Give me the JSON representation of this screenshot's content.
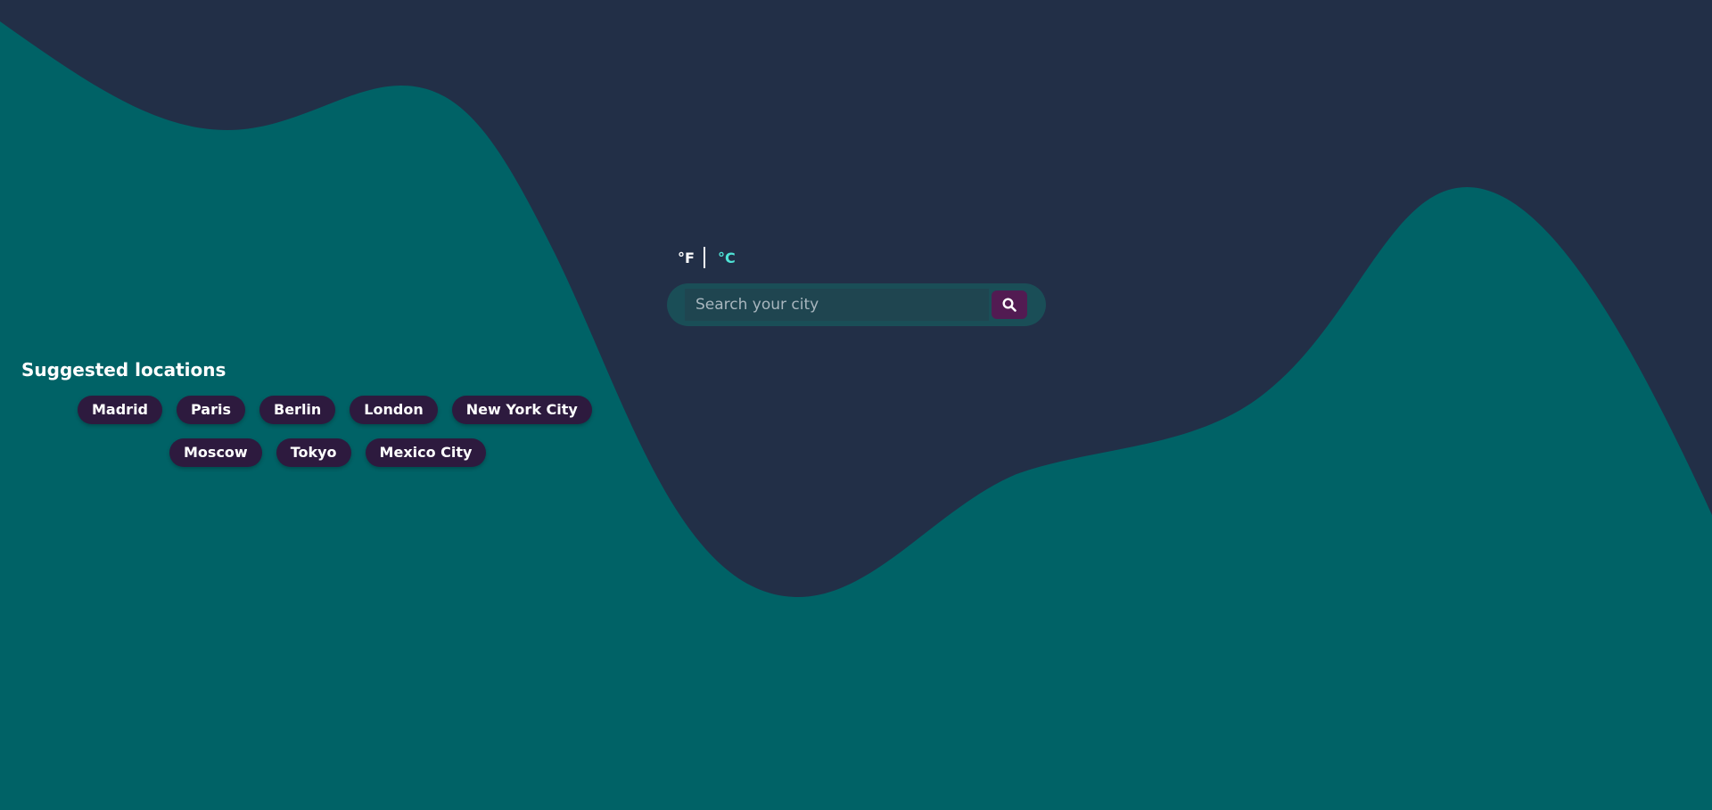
{
  "colors": {
    "background": "#222f47",
    "wave": "#006266",
    "unit_active": "#4fe3d6",
    "unit_inactive": "#ffffff",
    "search_button": "#521b52",
    "chip_bg": "#2d1a3e"
  },
  "units": {
    "fahrenheit": "°F",
    "celsius": "°C",
    "selected": "°C"
  },
  "search": {
    "placeholder": "Search your city",
    "value": "",
    "button_icon": "search-icon"
  },
  "suggested": {
    "title": "Suggested locations",
    "rows": [
      [
        "Madrid",
        "Paris",
        "Berlin",
        "London",
        "New York City"
      ],
      [
        "Moscow",
        "Tokyo",
        "Mexico City"
      ]
    ]
  }
}
